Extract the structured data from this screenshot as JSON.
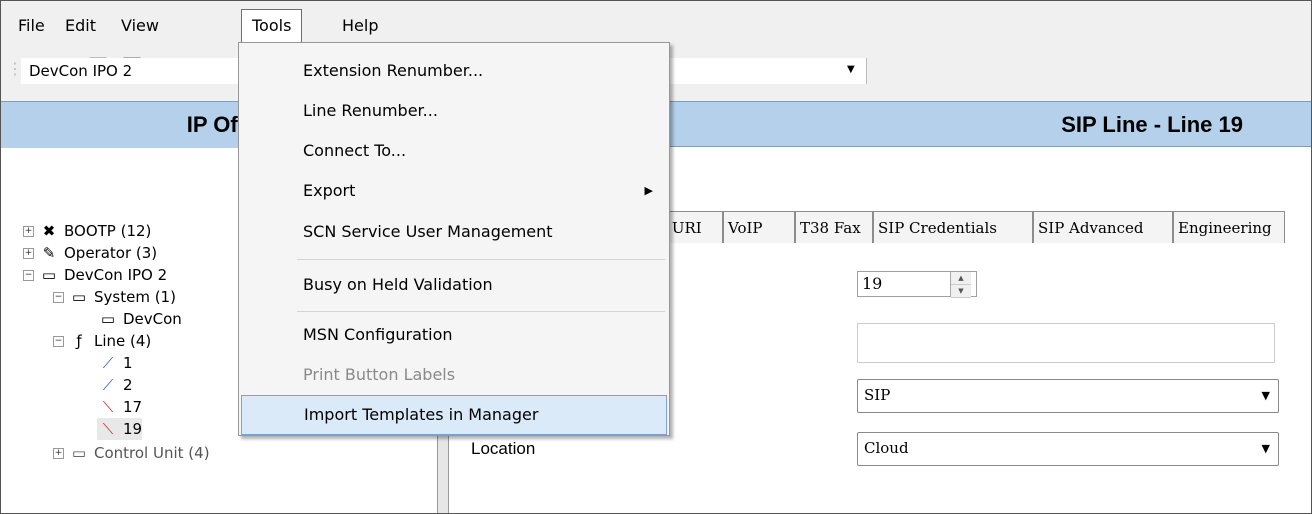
{
  "menubar": {
    "items": [
      "File",
      "Edit",
      "View",
      "Tools",
      "Help"
    ]
  },
  "toolbar": {
    "icons": [
      "user-icon",
      "open-folder-icon",
      "save-icon",
      "panel-icon"
    ]
  },
  "selector": {
    "value": "DevCon IPO 2"
  },
  "left_header": {
    "title": "IP Offi"
  },
  "right_header": {
    "title": "SIP Line - Line 19"
  },
  "tree": {
    "items": [
      {
        "label": "BOOTP (12)",
        "icon": "bootp-icon"
      },
      {
        "label": "Operator (3)",
        "icon": "operator-icon"
      },
      {
        "label": "DevCon IPO 2",
        "icon": "system-unit-icon"
      },
      {
        "label": "System (1)",
        "icon": "system-icon"
      },
      {
        "label": "DevCon",
        "icon": "system-unit-icon"
      },
      {
        "label": "Line (4)",
        "icon": "line-icon"
      },
      {
        "label": "1",
        "icon": "cable-blue-icon"
      },
      {
        "label": "2",
        "icon": "cable-blue-icon"
      },
      {
        "label": "17",
        "icon": "cable-red-icon"
      },
      {
        "label": "19",
        "icon": "cable-red-icon"
      },
      {
        "label": "Control Unit (4)",
        "icon": "folder-icon"
      }
    ]
  },
  "tabs": [
    "P URI",
    "VoIP",
    "T38 Fax",
    "SIP Credentials",
    "SIP Advanced",
    "Engineering"
  ],
  "form": {
    "line_number": "19",
    "text_field": "",
    "transport_select": "SIP",
    "location_label": "Location",
    "location_select": "Cloud"
  },
  "tools_menu": {
    "items": [
      {
        "label": "Extension Renumber...",
        "enabled": true
      },
      {
        "label": "Line Renumber...",
        "enabled": true
      },
      {
        "label": "Connect To...",
        "enabled": true
      },
      {
        "label": "Export",
        "enabled": true,
        "submenu": true
      },
      {
        "label": "SCN Service User Management",
        "enabled": true
      },
      {
        "label": "Busy on Held Validation",
        "enabled": true
      },
      {
        "label": "MSN Configuration",
        "enabled": true
      },
      {
        "label": "Print Button Labels",
        "enabled": false
      },
      {
        "label": "Import Templates in Manager",
        "enabled": true,
        "highlighted": true
      }
    ]
  }
}
